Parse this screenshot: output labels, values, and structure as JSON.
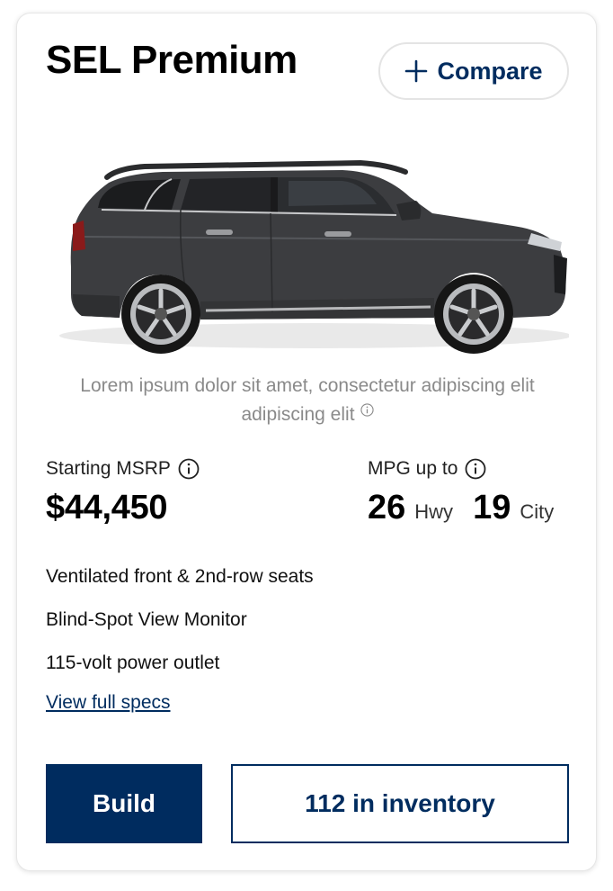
{
  "card": {
    "title": "SEL Premium",
    "compare_label": "Compare",
    "image_alt": "dark gray three-row SUV side view",
    "disclaimer": "Lorem ipsum dolor sit amet, consectetur adipiscing elit adipiscing elit",
    "msrp": {
      "label": "Starting MSRP",
      "value": "$44,450"
    },
    "mpg": {
      "label": "MPG up to",
      "hwy_value": "26",
      "hwy_unit": "Hwy",
      "city_value": "19",
      "city_unit": "City"
    },
    "features": [
      "Ventilated front & 2nd-row seats",
      "Blind-Spot View Monitor",
      "115-volt power outlet"
    ],
    "specs_link": "View full specs",
    "build_label": "Build",
    "inventory_label": "112 in inventory"
  },
  "colors": {
    "brand_navy": "#002c5f",
    "car_body": "#3c3d40",
    "muted_text": "#8a8a8a"
  },
  "icons": [
    "plus-icon",
    "info-icon",
    "car-image"
  ]
}
